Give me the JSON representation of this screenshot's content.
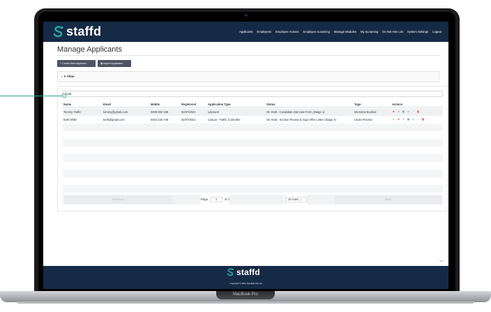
{
  "device": {
    "label": "MacBook Pro"
  },
  "nav": {
    "logo": "staffd",
    "items": [
      "Applicants",
      "Employees",
      "Employee Actions",
      "Employee eLearning",
      "Manage Modules",
      "My eLearning",
      "Do Not Hire List",
      "System Settings",
      "Logout"
    ]
  },
  "page": {
    "title": "Manage Applicants",
    "create_button": "+ Create New Applicant",
    "import_button": "Import Applicants",
    "filter_label": "Filter",
    "search_value": "hold"
  },
  "table": {
    "headers": [
      "Name",
      "Email",
      "Mobile",
      "Registered",
      "Application Type",
      "Status",
      "Tags",
      "Actions"
    ],
    "rows": [
      {
        "name": "Tommy Traffic",
        "email": "tommy@gmail.com",
        "mobile": "0499 082 348",
        "registered": "02/07/2021",
        "type": "Labourer",
        "status": "On Hold - Candidate Interview Form (Stage 1)",
        "tags": "Interview Booked",
        "actions": [
          "reject-icon",
          "link-icon",
          "document-icon",
          "tag-icon",
          "comment-icon",
          "trash-icon"
        ]
      },
      {
        "name": "Beth Miller",
        "email": "beth@gmail.com",
        "mobile": "0482 438 738",
        "registered": "02/07/2021",
        "type": "Casual - Traffic Controller",
        "status": "On Hold - Section Review & Sign Offer Letter (Stage 3)",
        "tags": "Under Review",
        "actions": [
          "approve-icon",
          "reject-icon",
          "link-icon",
          "document-icon",
          "tag-icon",
          "comment-icon",
          "trash-icon"
        ]
      }
    ]
  },
  "pagination": {
    "previous": "Previous",
    "page_label": "Page",
    "page_value": "1",
    "of_label": "of 1",
    "rows_select": "10 rows",
    "next": "Next"
  },
  "footer": {
    "logo": "staffd",
    "copyright": "Copyright © 2021 Solvable Pty Ltd",
    "version": "v1.3"
  },
  "colors": {
    "nav": "#152a45",
    "accent": "#2aa39b",
    "button": "#4d5463"
  }
}
